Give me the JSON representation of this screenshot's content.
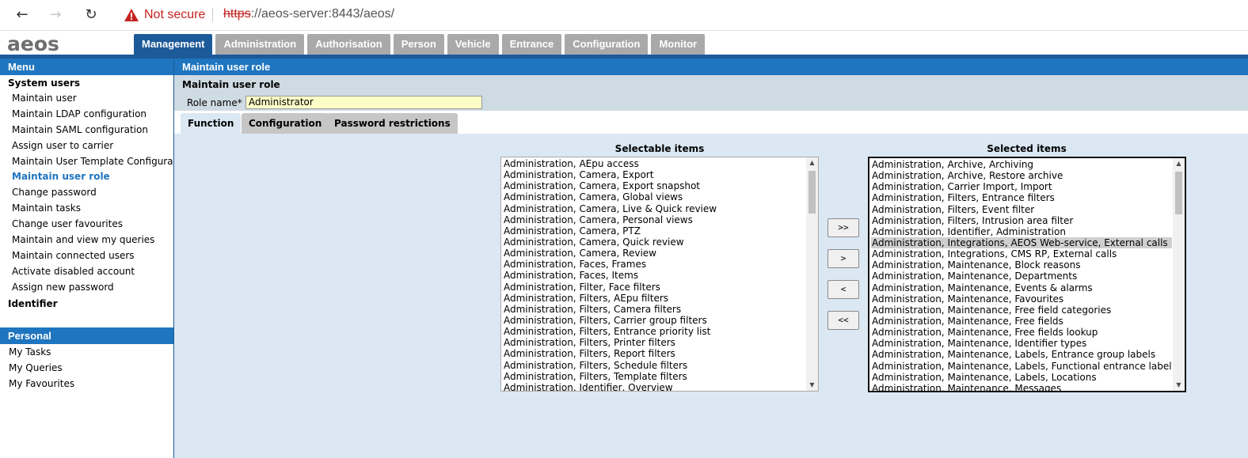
{
  "browser": {
    "not_secure": "Not secure",
    "url_proto": "https",
    "url_rest": "://aeos-server:8443/aeos/"
  },
  "app": {
    "logo": "aeos",
    "tabs": [
      "Management",
      "Administration",
      "Authorisation",
      "Person",
      "Vehicle",
      "Entrance",
      "Configuration",
      "Monitor"
    ],
    "active_tab": "Management"
  },
  "sidebar": {
    "menu_title": "Menu",
    "group_system_users": "System users",
    "items": [
      "Maintain user",
      "Maintain LDAP configuration",
      "Maintain SAML configuration",
      "Assign user to carrier",
      "Maintain User Template Configuration",
      "Maintain user role",
      "Change password",
      "Maintain tasks",
      "Change user favourites",
      "Maintain and view my queries",
      "Maintain connected users",
      "Activate disabled account",
      "Assign new password"
    ],
    "current_item": "Maintain user role",
    "group_identifier": "Identifier",
    "personal_title": "Personal",
    "personal_items": [
      "My Tasks",
      "My Queries",
      "My Favourites"
    ]
  },
  "main": {
    "header": "Maintain user role",
    "form_title": "Maintain user role",
    "role_label": "Role name*",
    "role_value": "Administrator",
    "tabs": [
      "Function",
      "Configuration",
      "Password restrictions"
    ],
    "active_tab": "Function",
    "selectable_title": "Selectable items",
    "selected_title": "Selected items",
    "buttons": {
      "add_all": ">>",
      "add": ">",
      "remove": "<",
      "remove_all": "<<"
    },
    "selectable_items": [
      "Administration, AEpu access",
      "Administration, Camera, Export",
      "Administration, Camera, Export snapshot",
      "Administration, Camera, Global views",
      "Administration, Camera, Live & Quick review",
      "Administration, Camera, Personal views",
      "Administration, Camera, PTZ",
      "Administration, Camera, Quick review",
      "Administration, Camera, Review",
      "Administration, Faces, Frames",
      "Administration, Faces, Items",
      "Administration, Filter, Face filters",
      "Administration, Filters, AEpu filters",
      "Administration, Filters, Camera filters",
      "Administration, Filters, Carrier group filters",
      "Administration, Filters, Entrance priority list",
      "Administration, Filters, Printer filters",
      "Administration, Filters, Report filters",
      "Administration, Filters, Schedule filters",
      "Administration, Filters, Template filters",
      "Administration, Identifier, Overview"
    ],
    "selected_items": [
      "Administration, Archive, Archiving",
      "Administration, Archive, Restore archive",
      "Administration, Carrier Import, Import",
      "Administration, Filters, Entrance filters",
      "Administration, Filters, Event filter",
      "Administration, Filters, Intrusion area filter",
      "Administration, Identifier, Administration",
      "Administration, Integrations, AEOS Web-service, External calls",
      "Administration, Integrations, CMS RP, External calls",
      "Administration, Maintenance, Block reasons",
      "Administration, Maintenance, Departments",
      "Administration, Maintenance, Events & alarms",
      "Administration, Maintenance, Favourites",
      "Administration, Maintenance, Free field categories",
      "Administration, Maintenance, Free fields",
      "Administration, Maintenance, Free fields lookup",
      "Administration, Maintenance, Identifier types",
      "Administration, Maintenance, Labels, Entrance group labels",
      "Administration, Maintenance, Labels, Functional entrance labels",
      "Administration, Maintenance, Labels, Locations",
      "Administration, Maintenance, Messages"
    ],
    "highlighted_selected": "Administration, Integrations, AEOS Web-service, External calls"
  }
}
